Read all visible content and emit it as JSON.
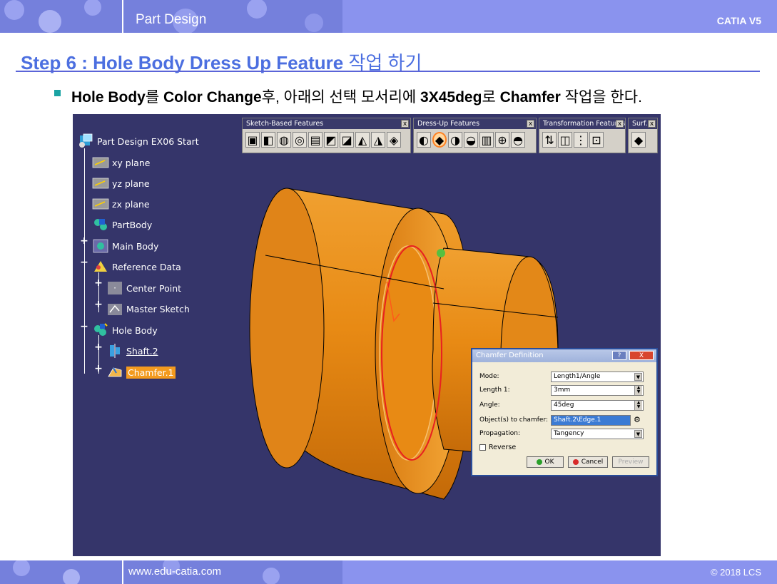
{
  "header": {
    "title": "Part Design",
    "product": "CATIA V5"
  },
  "step": {
    "title_en": "Step 6 : Hole Body Dress Up Feature",
    "title_ko": "작업 하기"
  },
  "instruction": {
    "p1": "Hole Body",
    "p2": "를 ",
    "p3": "Color Change",
    "p4": "후, 아래의 선택 모서리에 ",
    "p5": "3X45deg",
    "p6": "로 ",
    "p7": "Chamfer",
    "p8": " 작업을 한다."
  },
  "tree": {
    "items": [
      {
        "label": "Part Design EX06 Start",
        "icon": "part-icon"
      },
      {
        "label": "xy plane",
        "icon": "plane-icon"
      },
      {
        "label": "yz plane",
        "icon": "plane-icon"
      },
      {
        "label": "zx plane",
        "icon": "plane-icon"
      },
      {
        "label": "PartBody",
        "icon": "body-icon"
      },
      {
        "label": "Main Body",
        "icon": "body-icon"
      },
      {
        "label": "Reference Data",
        "icon": "geometrical-set-icon"
      },
      {
        "label": "Center Point",
        "icon": "point-icon"
      },
      {
        "label": "Master Sketch",
        "icon": "sketch-icon"
      },
      {
        "label": "Hole Body",
        "icon": "body-icon"
      },
      {
        "label": "Shaft.2",
        "icon": "shaft-icon"
      },
      {
        "label": "Chamfer.1",
        "icon": "chamfer-icon"
      }
    ]
  },
  "toolbars": {
    "sketch_based": "Sketch-Based Features",
    "dress_up": "Dress-Up Features",
    "transformation": "Transformation Features",
    "surface": "Surf..."
  },
  "dialog": {
    "title": "Chamfer Definition",
    "help": "?",
    "close": "X",
    "mode_label": "Mode:",
    "mode_value": "Length1/Angle",
    "length_label": "Length 1:",
    "length_value": "3mm",
    "angle_label": "Angle:",
    "angle_value": "45deg",
    "objects_label": "Object(s) to chamfer:",
    "objects_value": "Shaft.2\\Edge.1",
    "propagation_label": "Propagation:",
    "propagation_value": "Tangency",
    "reverse_label": "Reverse",
    "ok": "OK",
    "cancel": "Cancel",
    "preview": "Preview"
  },
  "footer": {
    "website": "www.edu-catia.com",
    "copyright": "© 2018 LCS"
  },
  "colors": {
    "band": "#8a93ee",
    "title": "#4c6fe0",
    "viewport": "#35356a",
    "part": "#e88a14",
    "selection": "#f39a1e"
  }
}
